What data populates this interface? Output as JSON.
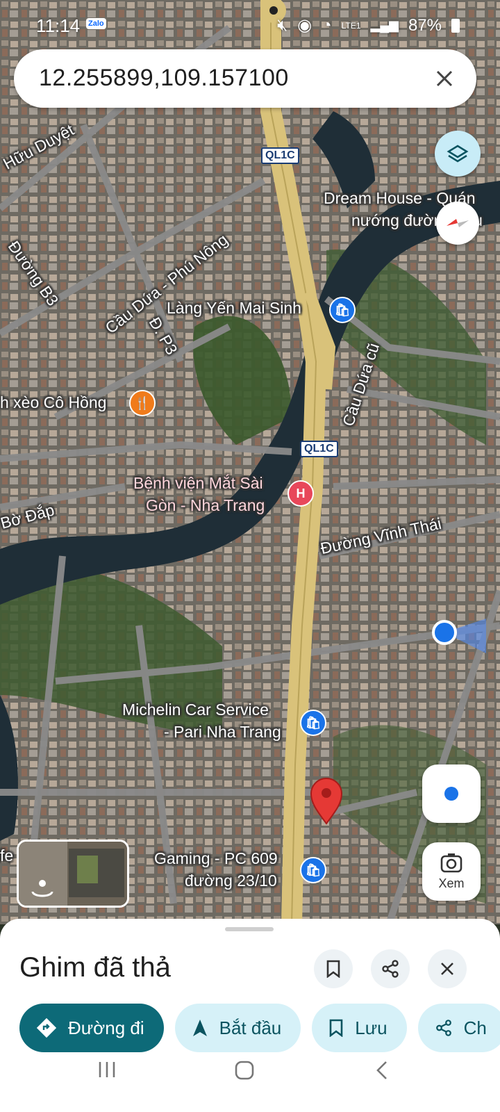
{
  "status_bar": {
    "time": "11:14",
    "app_badge": "Zalo",
    "network": "LTE1",
    "battery": "87%"
  },
  "search": {
    "value": "12.255899,109.157100"
  },
  "map": {
    "labels": {
      "street_huu_duyet": "Hữu Duyệt",
      "street_b3": "Đường B3",
      "street_cau_dua_phu_nong": "Cầu Dứa - Phú Nông",
      "street_p3": "Đ. P3",
      "street_bo_dap": "Bờ Đắp",
      "street_cau_dua_cu": "Cầu Dứa cũ",
      "street_vinh_thai": "Đường Vĩnh Thái",
      "road_ql1c_top": "QL1C",
      "road_ql1c_mid": "QL1C",
      "poi_dream_house_1": "Dream House - Quán",
      "poi_dream_house_2": "nướng đường Lâu",
      "poi_lang_yen": "Làng Yến Mai Sinh",
      "poi_banh_xeo": "h xèo Cô Hồng",
      "poi_hospital_1": "Bệnh viện Mắt Sài",
      "poi_hospital_2": "Gòn - Nha Trang",
      "poi_michelin_1": "Michelin Car Service",
      "poi_michelin_2": "- Pari Nha Trang",
      "poi_gaming_1": "Gaming - PC 609",
      "poi_gaming_2": "đường 23/10",
      "edge_fe": "fe"
    }
  },
  "buttons": {
    "lens_label": "Xem"
  },
  "sheet": {
    "title": "Ghim đã thả",
    "chips": {
      "directions": "Đường đi",
      "start": "Bắt đầu",
      "save": "Lưu",
      "share": "Ch"
    }
  },
  "icons": {
    "search_close": "close-icon",
    "layers": "layers-icon",
    "compass": "compass-icon",
    "my_location": "my-location-icon",
    "lens": "lens-icon",
    "bookmark": "bookmark-icon",
    "share": "share-icon",
    "close": "close-icon"
  },
  "colors": {
    "primary_chip": "#0d6a78",
    "secondary_chip": "#d6f1f8",
    "pin": "#e53935",
    "blue_dot": "#1a73e8",
    "highway": "#d9c27a"
  }
}
